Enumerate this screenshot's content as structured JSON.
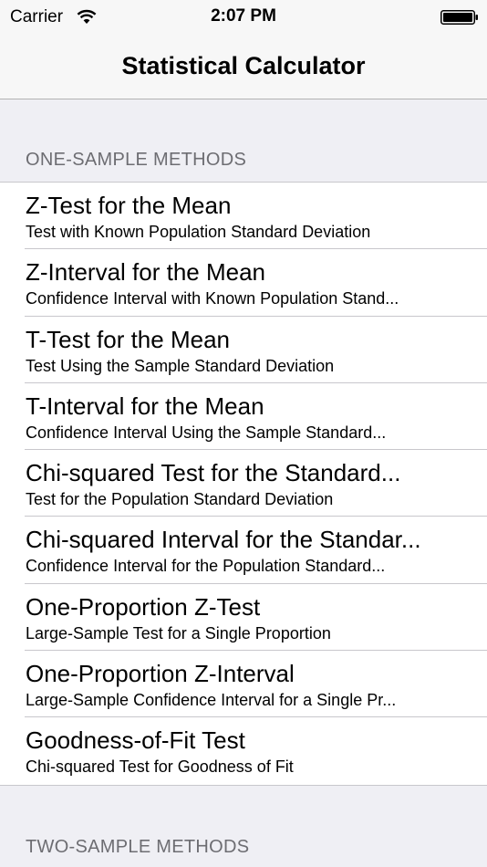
{
  "status_bar": {
    "carrier": "Carrier",
    "time": "2:07 PM",
    "wifi_icon": "wifi-icon",
    "battery_icon": "battery-icon"
  },
  "nav": {
    "title": "Statistical Calculator"
  },
  "sections": [
    {
      "header": "ONE-SAMPLE METHODS",
      "items": [
        {
          "title": "Z-Test for the Mean",
          "subtitle": "Test with Known Population Standard Deviation"
        },
        {
          "title": "Z-Interval for the Mean",
          "subtitle": "Confidence Interval with Known Population Stand..."
        },
        {
          "title": "T-Test for the Mean",
          "subtitle": "Test Using the Sample Standard Deviation"
        },
        {
          "title": "T-Interval for the Mean",
          "subtitle": "Confidence Interval Using the Sample Standard..."
        },
        {
          "title": "Chi-squared Test for the Standard...",
          "subtitle": "Test for the Population Standard Deviation"
        },
        {
          "title": "Chi-squared Interval for the Standar...",
          "subtitle": "Confidence Interval for the Population Standard..."
        },
        {
          "title": "One-Proportion Z-Test",
          "subtitle": "Large-Sample Test for a Single Proportion"
        },
        {
          "title": "One-Proportion Z-Interval",
          "subtitle": "Large-Sample Confidence Interval for a Single Pr..."
        },
        {
          "title": "Goodness-of-Fit Test",
          "subtitle": "Chi-squared Test for Goodness of Fit"
        }
      ]
    },
    {
      "header": "TWO-SAMPLE METHODS",
      "items": []
    }
  ]
}
